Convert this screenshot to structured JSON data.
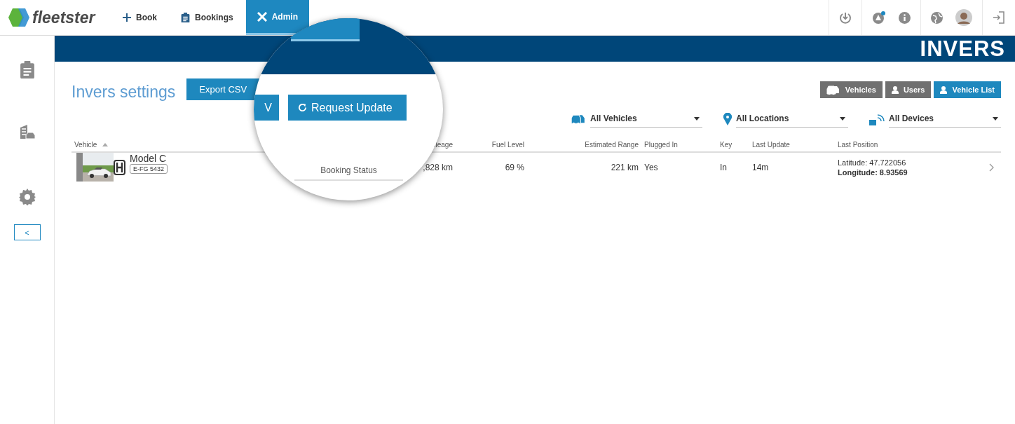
{
  "brand": {
    "name": "fleetster"
  },
  "nav": {
    "tabs": [
      {
        "label": "Book",
        "selected": false
      },
      {
        "label": "Bookings",
        "selected": false
      },
      {
        "label": "Admin",
        "selected": true
      }
    ]
  },
  "sidebar": {
    "collapse": "<"
  },
  "banner": {
    "logo": "INVERS"
  },
  "page": {
    "title": "Invers settings",
    "actions": [
      "Export CSV"
    ],
    "views": [
      {
        "label": "Vehicles",
        "selected": false
      },
      {
        "label": "Users",
        "selected": false
      },
      {
        "label": "Vehicle List",
        "selected": true
      }
    ]
  },
  "filters": [
    {
      "kind": "vehicles",
      "value": "All Vehicles"
    },
    {
      "kind": "locations",
      "value": "All Locations"
    },
    {
      "kind": "devices",
      "value": "All Devices"
    }
  ],
  "table": {
    "columns": [
      "Vehicle",
      "ileage",
      "Fuel Level",
      "Estimated Range",
      "Plugged In",
      "Key",
      "Last Update",
      "Last Position"
    ],
    "rows": [
      {
        "vehicle": {
          "name": "Model C",
          "plate": "E-FG 5432"
        },
        "mileage": ",828 km",
        "fuel_level": "69 %",
        "estimated_range": "221 km",
        "plugged_in": "Yes",
        "key": "In",
        "last_update": "14m",
        "last_position": {
          "latitude": "Latitude: 47.722056",
          "longitude": "Longitude: 8.93569"
        }
      }
    ]
  },
  "magnifier": {
    "actions": [
      "V",
      "Request Update"
    ],
    "column": "Booking Status"
  }
}
